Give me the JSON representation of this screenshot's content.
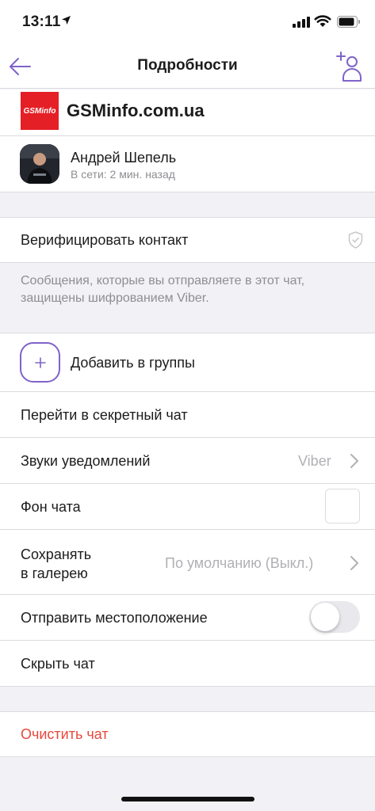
{
  "status_bar": {
    "time": "13:11"
  },
  "header": {
    "title": "Подробности"
  },
  "brand": {
    "logo_text": "GSMinfo",
    "site": "GSMinfo.com.ua"
  },
  "contact": {
    "name": "Андрей Шепель",
    "status": "В сети: 2 мин. назад"
  },
  "security": {
    "verify_label": "Верифицировать контакт",
    "encryption_note": "Сообщения, которые вы отправляете в этот чат, защищены шифрованием Viber."
  },
  "settings": {
    "add_to_groups": "Добавить в группы",
    "secret_chat": "Перейти в секретный чат",
    "notification_sounds": {
      "label": "Звуки уведомлений",
      "value": "Viber"
    },
    "chat_background": {
      "label": "Фон чата"
    },
    "save_to_gallery": {
      "label_line1": "Сохранять",
      "label_line2": "в галерею",
      "value": "По умолчанию (Выкл.)"
    },
    "send_location": {
      "label": "Отправить местоположение",
      "enabled": false
    },
    "hide_chat": "Скрыть чат",
    "clear_chat": "Очистить чат"
  },
  "colors": {
    "accent": "#7f63c9",
    "destructive": "#e8483c",
    "background": "#f2f1f6"
  }
}
